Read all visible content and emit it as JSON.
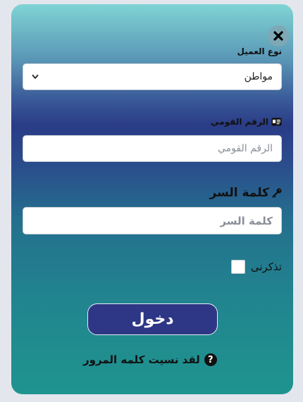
{
  "close_icon": "close-icon",
  "customer_type": {
    "label": "نوع العميل",
    "selected": "مواطن"
  },
  "national_id": {
    "label": "الرقم القومي",
    "placeholder": "الرقم القومي",
    "icon": "id-card-icon"
  },
  "password": {
    "label": "كلمة السر",
    "placeholder": "كلمة السر",
    "icon": "key-icon"
  },
  "remember_me": {
    "label": "تذكرنى",
    "checked": false
  },
  "login_button": {
    "label": "دخول"
  },
  "forgot_password": {
    "label": "لقد نسيت كلمه المرور",
    "icon": "question-icon"
  },
  "colors": {
    "button_bg": "#2d3785",
    "panel_top": "#7fd4d4",
    "panel_bottom": "#1f948f"
  }
}
